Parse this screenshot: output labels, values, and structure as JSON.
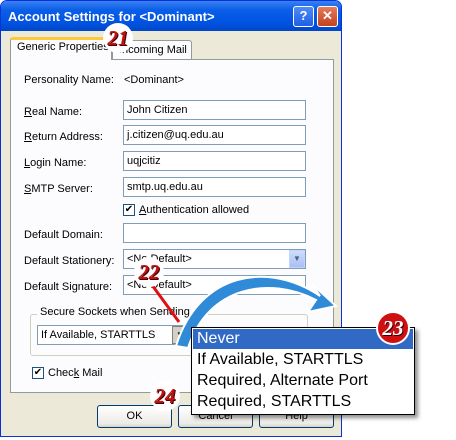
{
  "window": {
    "title": "Account Settings for  <Dominant>",
    "help_glyph": "?",
    "close_glyph": "✕"
  },
  "tabs": [
    {
      "label": "Generic Properties",
      "active": true
    },
    {
      "label": "Incoming Mail",
      "active": false
    }
  ],
  "fields": {
    "personality_name": {
      "label": "Personality Name:",
      "value": "<Dominant>"
    },
    "real_name": {
      "label_u": "R",
      "label_rest": "eal Name:",
      "value": "John Citizen"
    },
    "return_address": {
      "label_u": "R",
      "label_rest": "eturn Address:",
      "value": "j.citizen@uq.edu.au"
    },
    "login_name": {
      "label_u": "L",
      "label_rest": "ogin Name:",
      "value": "uqjcitiz"
    },
    "smtp_server": {
      "label_u": "S",
      "label_rest": "MTP Server:",
      "value": "smtp.uq.edu.au"
    },
    "auth_allowed": {
      "label_u": "A",
      "label_rest": "uthentication allowed",
      "checked": true
    },
    "default_domain": {
      "label": "Default Domain:",
      "value": ""
    },
    "default_stationery": {
      "label": "Default Stationery:",
      "value": "<No Default>"
    },
    "default_signature": {
      "label": "Default Signature:",
      "value": "<No Default>"
    }
  },
  "secure_sockets": {
    "legend": "Secure Sockets when Sending",
    "value": "If Available, STARTTLS"
  },
  "check_mail": {
    "label_pre": "Chec",
    "label_u": "k",
    "label_rest": " Mail",
    "checked": true
  },
  "buttons": {
    "ok": "OK",
    "cancel": "Cancel",
    "help": "Help"
  },
  "dropdown_options": [
    {
      "label": "Never",
      "selected": true
    },
    {
      "label": "If Available, STARTTLS",
      "selected": false
    },
    {
      "label": "Required, Alternate Port",
      "selected": false
    },
    {
      "label": "Required, STARTTLS",
      "selected": false
    }
  ],
  "callouts": [
    "21",
    "22",
    "23",
    "24"
  ],
  "colors": {
    "title_bar": "#0054e3",
    "selection": "#316ac5",
    "callout_arrow": "#2f8ad8",
    "callout_line": "#e01010"
  }
}
